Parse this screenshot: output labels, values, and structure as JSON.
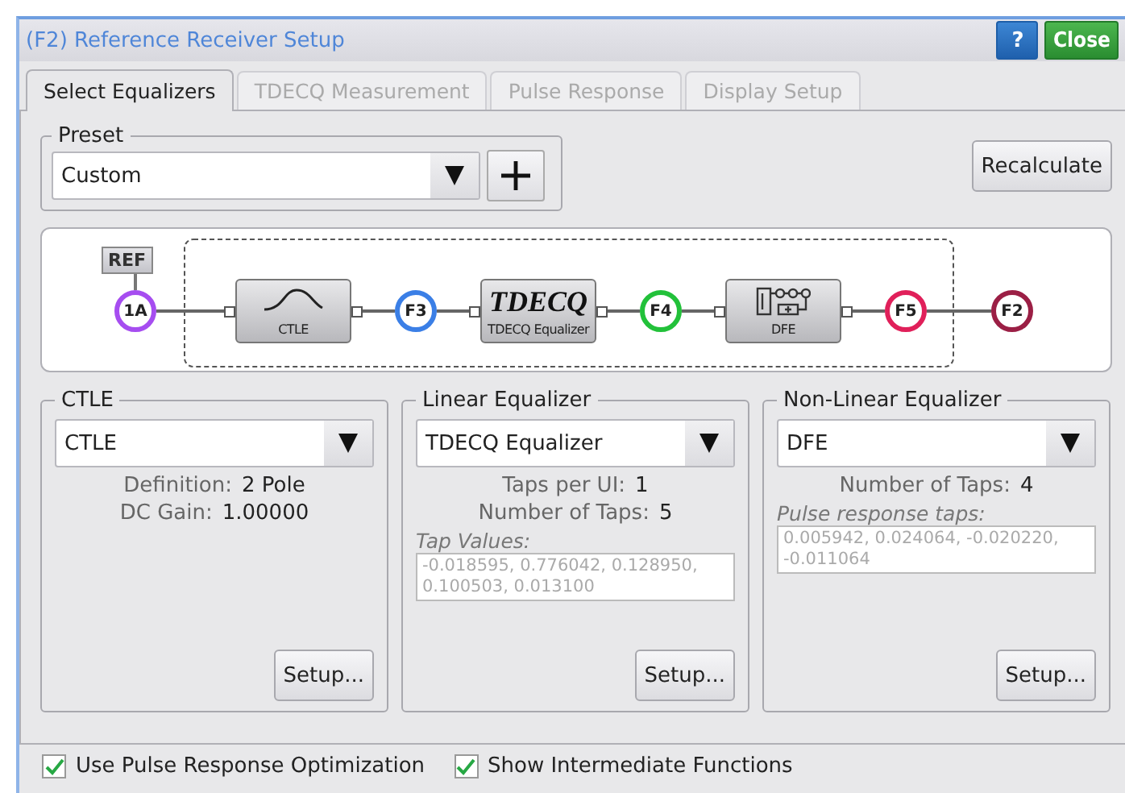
{
  "window": {
    "title": "(F2) Reference Receiver Setup",
    "help_button": "?",
    "close_button": "Close"
  },
  "tabs": [
    {
      "label": "Select Equalizers",
      "selected": true
    },
    {
      "label": "TDECQ Measurement",
      "selected": false
    },
    {
      "label": "Pulse Response",
      "selected": false
    },
    {
      "label": "Display Setup",
      "selected": false
    }
  ],
  "preset": {
    "legend": "Preset",
    "value": "Custom"
  },
  "recalculate_button": "Recalculate",
  "diagram": {
    "ref_label": "REF",
    "items": [
      {
        "kind": "node",
        "label": "1A",
        "color": "#a64df0"
      },
      {
        "kind": "curve",
        "label": "CTLE"
      },
      {
        "kind": "node",
        "label": "F3",
        "color": "#3b7fe6"
      },
      {
        "kind": "title",
        "title": "TDECQ",
        "label": "TDECQ Equalizer"
      },
      {
        "kind": "node",
        "label": "F4",
        "color": "#22c13a"
      },
      {
        "kind": "circuit",
        "label": "DFE"
      },
      {
        "kind": "node",
        "label": "F5",
        "color": "#e0205a"
      },
      {
        "kind": "node",
        "label": "F2",
        "color": "#9b1f45"
      }
    ]
  },
  "groups": [
    {
      "legend": "CTLE",
      "value": "CTLE",
      "fields": [
        {
          "label": "Definition:",
          "value": "2 Pole"
        },
        {
          "label": "DC Gain:",
          "value": "1.00000"
        }
      ],
      "setup_button": "Setup..."
    },
    {
      "legend": "Linear Equalizer",
      "value": "TDECQ Equalizer",
      "fields": [
        {
          "label": "Taps per UI:",
          "value": "1"
        },
        {
          "label": "Number of Taps:",
          "value": "5"
        }
      ],
      "taps": {
        "label": "Tap Values:",
        "value": "-0.018595, 0.776042, 0.128950, 0.100503, 0.013100"
      },
      "setup_button": "Setup..."
    },
    {
      "legend": "Non-Linear Equalizer",
      "value": "DFE",
      "fields": [
        {
          "label": "Number of Taps:",
          "value": "4"
        }
      ],
      "taps": {
        "label": "Pulse response taps:",
        "value": "0.005942, 0.024064, -0.020220, -0.011064"
      },
      "setup_button": "Setup..."
    }
  ],
  "checkboxes": [
    {
      "label": "Use Pulse Response Optimization",
      "checked": true
    },
    {
      "label": "Show Intermediate Functions",
      "checked": true
    }
  ]
}
